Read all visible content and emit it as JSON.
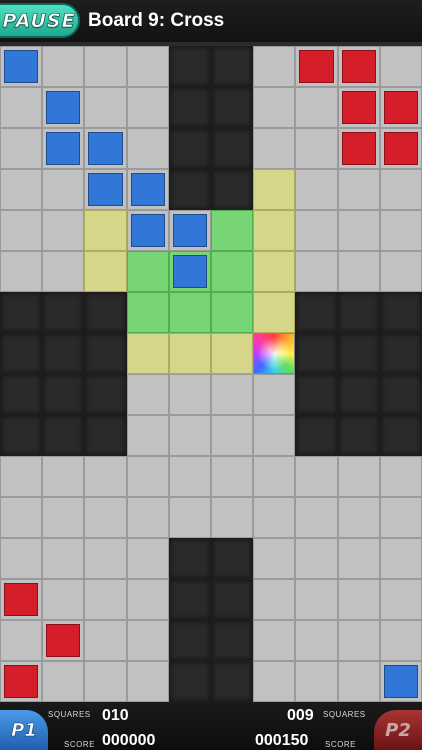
{
  "header": {
    "pause_label": "PAUSE",
    "board_title": "Board 9: Cross"
  },
  "board": {
    "columns": 10,
    "rows": 16,
    "grid": [
      "GGGGDDGGGG",
      "GGGGDDGGGG",
      "GGGGDDGGGG",
      "GGGGDDYGGG",
      "GGYGGNYGGG",
      "GGYNNNYGGG",
      "DDDNNNYDDD",
      "DDDYYYRDDD",
      "DDDGGGGDDD",
      "DDDGGGGDDD",
      "GGGGGGGGGG",
      "GGGGGGGGGG",
      "GGGGDDGGGG",
      "GGGGDDGGGG",
      "GGGGDDGGGG",
      "GGGGDDGGGG"
    ],
    "legend": {
      "G": "gray",
      "D": "dark",
      "N": "green",
      "Y": "yellow",
      "R": "rainbow"
    },
    "pieces": [
      {
        "player": "p1",
        "color": "blue",
        "row": 0,
        "col": 0
      },
      {
        "player": "p1",
        "color": "blue",
        "row": 1,
        "col": 1
      },
      {
        "player": "p1",
        "color": "blue",
        "row": 2,
        "col": 1
      },
      {
        "player": "p1",
        "color": "blue",
        "row": 2,
        "col": 2
      },
      {
        "player": "p1",
        "color": "blue",
        "row": 3,
        "col": 2
      },
      {
        "player": "p1",
        "color": "blue",
        "row": 3,
        "col": 3
      },
      {
        "player": "p1",
        "color": "blue",
        "row": 4,
        "col": 3
      },
      {
        "player": "p1",
        "color": "blue",
        "row": 4,
        "col": 4
      },
      {
        "player": "p1",
        "color": "blue",
        "row": 5,
        "col": 4
      },
      {
        "player": "p1",
        "color": "blue",
        "row": 15,
        "col": 9
      },
      {
        "player": "p2",
        "color": "red",
        "row": 0,
        "col": 7
      },
      {
        "player": "p2",
        "color": "red",
        "row": 0,
        "col": 8
      },
      {
        "player": "p2",
        "color": "red",
        "row": 1,
        "col": 8
      },
      {
        "player": "p2",
        "color": "red",
        "row": 1,
        "col": 9
      },
      {
        "player": "p2",
        "color": "red",
        "row": 2,
        "col": 8
      },
      {
        "player": "p2",
        "color": "red",
        "row": 2,
        "col": 9
      },
      {
        "player": "p2",
        "color": "red",
        "row": 13,
        "col": 0
      },
      {
        "player": "p2",
        "color": "red",
        "row": 14,
        "col": 1
      },
      {
        "player": "p2",
        "color": "red",
        "row": 15,
        "col": 0
      }
    ],
    "colors": {
      "blue": "#3177d8",
      "red": "#d61d2a"
    }
  },
  "footer": {
    "p1": {
      "badge": "P1",
      "squares_label": "SQUARES",
      "squares": "010",
      "score_label": "SCORE",
      "score": "000000"
    },
    "p2": {
      "badge": "P2",
      "squares_label": "SQUARES",
      "squares": "009",
      "score_label": "SCORE",
      "score": "000150"
    }
  }
}
